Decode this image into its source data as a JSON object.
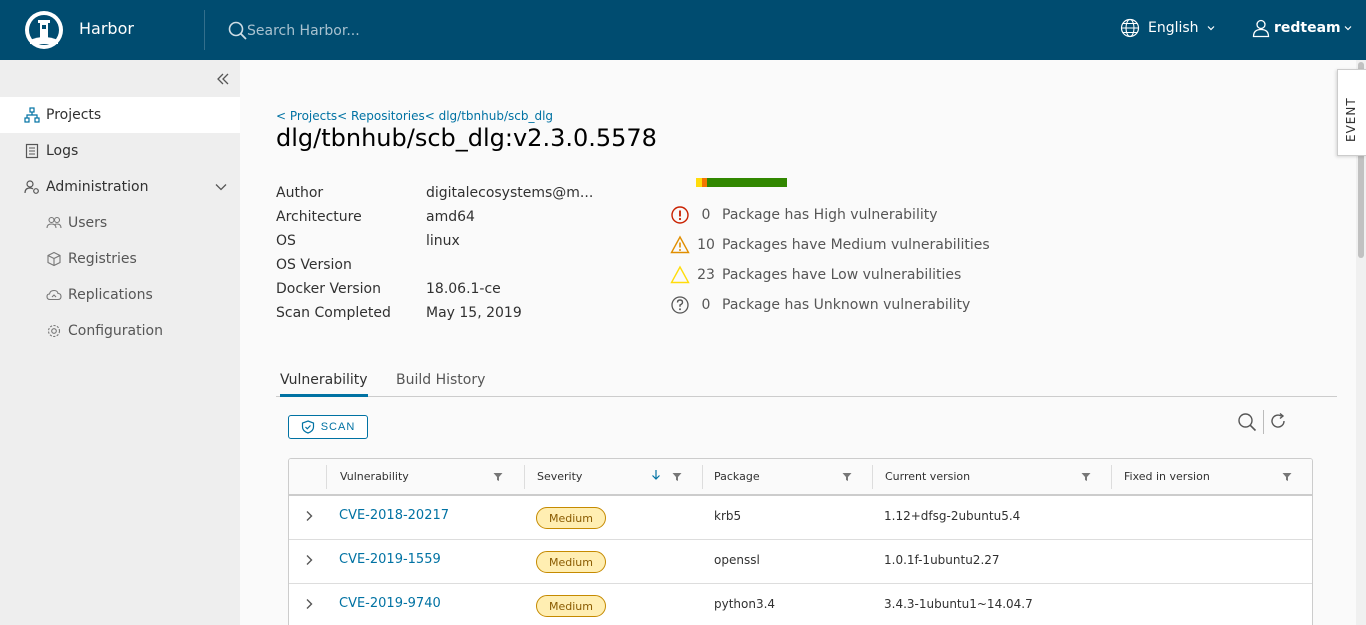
{
  "header": {
    "brand": "Harbor",
    "search_placeholder": "Search Harbor...",
    "language": "English",
    "user": "redteam"
  },
  "sidebar": {
    "items": [
      {
        "label": "Projects"
      },
      {
        "label": "Logs"
      },
      {
        "label": "Administration"
      }
    ],
    "admin_items": [
      {
        "label": "Users"
      },
      {
        "label": "Registries"
      },
      {
        "label": "Replications"
      },
      {
        "label": "Configuration"
      }
    ]
  },
  "breadcrumb": "< Projects< Repositories< dlg/tbnhub/scb_dlg",
  "page_title": "dlg/tbnhub/scb_dlg:v2.3.0.5578",
  "info": [
    {
      "label": "Author",
      "value": "digitalecosystems@m..."
    },
    {
      "label": "Architecture",
      "value": "amd64"
    },
    {
      "label": "OS",
      "value": "linux"
    },
    {
      "label": "OS Version",
      "value": ""
    },
    {
      "label": "Docker Version",
      "value": "18.06.1-ce"
    },
    {
      "label": "Scan Completed",
      "value": "May 15, 2019"
    }
  ],
  "vuln_summary": {
    "bar": {
      "low_fraction": 0.07,
      "medium_fraction": 0.05,
      "colors": {
        "none": "#318700",
        "low": "#ffdc0b",
        "medium": "#f57600"
      }
    },
    "rows": [
      {
        "icon": "high-severity-icon",
        "count": "0",
        "text": "Package has High vulnerability"
      },
      {
        "icon": "medium-severity-icon",
        "count": "10",
        "text": "Packages have Medium vulnerabilities"
      },
      {
        "icon": "low-severity-icon",
        "count": "23",
        "text": "Packages have Low vulnerabilities"
      },
      {
        "icon": "unknown-severity-icon",
        "count": "0",
        "text": "Package has Unknown vulnerability"
      }
    ]
  },
  "tabs": [
    {
      "label": "Vulnerability",
      "active": true
    },
    {
      "label": "Build History",
      "active": false
    }
  ],
  "scan_button": "SCAN",
  "grid": {
    "columns": [
      "Vulnerability",
      "Severity",
      "Package",
      "Current version",
      "Fixed in version"
    ],
    "rows": [
      {
        "cve": "CVE-2018-20217",
        "severity": "Medium",
        "package": "krb5",
        "current": "1.12+dfsg-2ubuntu5.4",
        "fixed": ""
      },
      {
        "cve": "CVE-2019-1559",
        "severity": "Medium",
        "package": "openssl",
        "current": "1.0.1f-1ubuntu2.27",
        "fixed": ""
      },
      {
        "cve": "CVE-2019-9740",
        "severity": "Medium",
        "package": "python3.4",
        "current": "3.4.3-1ubuntu1~14.04.7",
        "fixed": ""
      }
    ]
  },
  "event_tab": "EVENT",
  "colors": {
    "header": "#004c70",
    "link": "#0072a3",
    "medium_badge": "#ffeeb2"
  }
}
